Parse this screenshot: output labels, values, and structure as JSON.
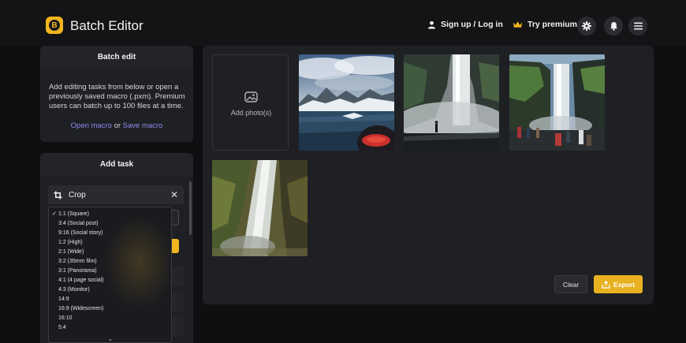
{
  "header": {
    "app_title": "Batch Editor",
    "logo_letter": "B",
    "signup_label": "Sign up / Log in",
    "premium_label": "Try premium",
    "icons": [
      "user-icon",
      "crown-icon",
      "gear-icon",
      "bell-icon",
      "menu-icon"
    ]
  },
  "batch_edit": {
    "title": "Batch edit",
    "description": "Add editing tasks from below or open a previously saved macro (.pxm). Premium users can batch up to 100 files at a time.",
    "open_macro": "Open macro",
    "or": "or",
    "save_macro": "Save macro"
  },
  "add_task": {
    "title": "Add task",
    "crop_label": "Crop",
    "close_symbol": "✕"
  },
  "ratio_dropdown": {
    "selected": "1:1 (Square)",
    "options": [
      "1:1 (Square)",
      "3:4 (Social post)",
      "9:16 (Social story)",
      "1:2 (High)",
      "2:1 (Wide)",
      "3:2 (35mm film)",
      "3:1 (Panorama)",
      "4:1 (4 page social)",
      "4:3 (Monitor)",
      "14:9",
      "16:9 (Widescreen)",
      "16:10",
      "5:4"
    ],
    "more_symbol": "⌄"
  },
  "gallery": {
    "add_photo_label": "Add photo(s)",
    "photos": [
      "glacier-lagoon",
      "waterfall-mist",
      "waterfall-cliff-crowd",
      "waterfall-closeup"
    ]
  },
  "actions": {
    "clear_label": "Clear",
    "export_label": "Export"
  },
  "colors": {
    "accent": "#f2b51e",
    "link": "#8f8cf0",
    "background": "#0f0f11",
    "panel": "#1f2024"
  }
}
